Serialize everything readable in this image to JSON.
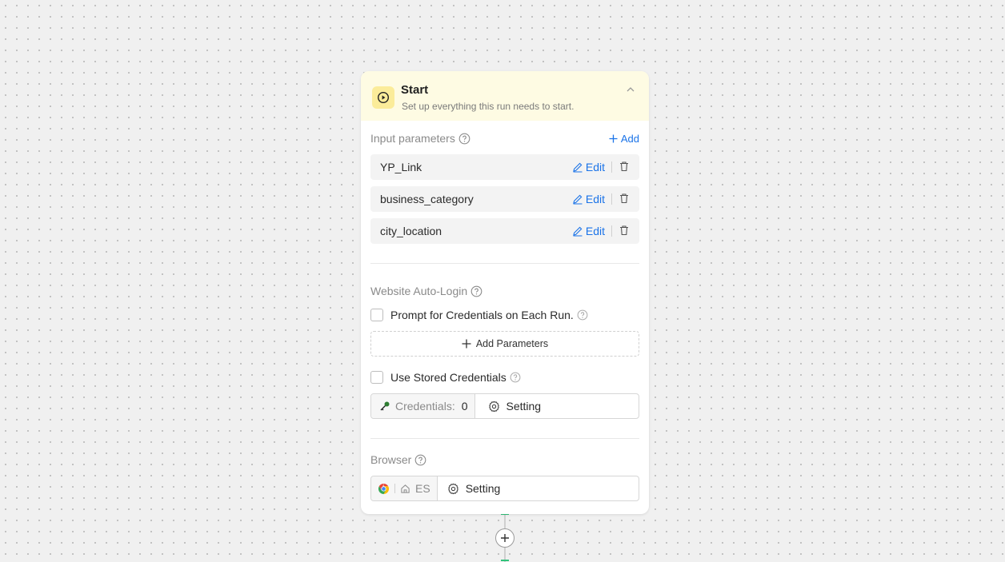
{
  "start_node": {
    "title": "Start",
    "subtitle": "Set up everything this run needs to start.",
    "header_color": "#fefbe3",
    "icon": "play-circle-icon"
  },
  "input_parameters": {
    "label": "Input parameters",
    "add_label": "Add",
    "items": [
      {
        "name": "YP_Link",
        "edit_label": "Edit"
      },
      {
        "name": "business_category",
        "edit_label": "Edit"
      },
      {
        "name": "city_location",
        "edit_label": "Edit"
      }
    ]
  },
  "auto_login": {
    "label": "Website Auto-Login",
    "prompt_checkbox_label": "Prompt for Credentials on Each Run.",
    "prompt_checked": false,
    "add_parameters_label": "Add Parameters",
    "stored_checkbox_label": "Use Stored Credentials",
    "stored_checked": false,
    "credentials_label": "Credentials:",
    "credentials_count": "0",
    "setting_label": "Setting"
  },
  "browser": {
    "label": "Browser",
    "region": "ES",
    "setting_label": "Setting"
  },
  "accent_color": "#1a73e8",
  "connector_color": "#2fc27a"
}
